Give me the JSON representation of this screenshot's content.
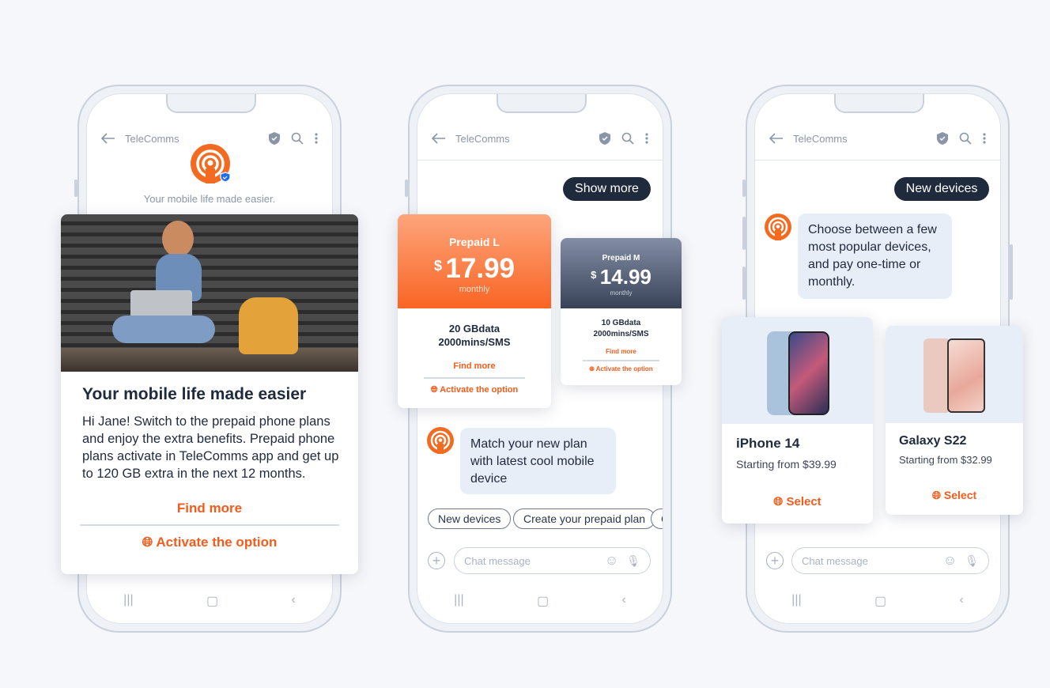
{
  "app_title": "TeleComms",
  "colors": {
    "accent": "#f35c1c",
    "dark": "#1f2a3d",
    "bubble": "#e8eef8"
  },
  "phone1": {
    "tagline": "Your mobile life made easier.",
    "card": {
      "title": "Your mobile life made easier",
      "body": "Hi Jane! Switch to the prepaid phone plans and enjoy the extra benefits. Prepaid phone plans activate in TeleComms app and get up to 120 GB extra in the next 12 months.",
      "find_more": "Find more",
      "activate": "Activate the option"
    }
  },
  "phone2": {
    "user_message": "Show more",
    "plans": [
      {
        "name": "Prepaid L",
        "currency": "$",
        "price": "17.99",
        "period": "monthly",
        "data": "20 GBdata",
        "mins": "2000mins/SMS",
        "find_more": "Find more",
        "activate": "Activate the option"
      },
      {
        "name": "Prepaid M",
        "currency": "$",
        "price": "14.99",
        "period": "monthly",
        "data": "10 GBdata",
        "mins": "2000mins/SMS",
        "find_more": "Find more",
        "activate": "Activate the option"
      }
    ],
    "bot_message": "Match your new plan with latest cool mobile device",
    "chips": [
      "New devices",
      "Create your prepaid plan",
      "C"
    ],
    "input_placeholder": "Chat message"
  },
  "phone3": {
    "user_message": "New devices",
    "bot_message": "Choose between a few most popular devices, and pay one-time or monthly.",
    "devices": [
      {
        "name": "iPhone 14",
        "price": "Starting from $39.99",
        "select": "Select"
      },
      {
        "name": "Galaxy S22",
        "price": "Starting from $32.99",
        "select": "Select"
      }
    ],
    "input_placeholder": "Chat message"
  },
  "icons": [
    "back-arrow-icon",
    "shield-check-icon",
    "search-icon",
    "more-vertical-icon",
    "globe-icon",
    "plus-icon",
    "emoji-icon",
    "microphone-icon",
    "recents-icon",
    "home-icon",
    "back-icon"
  ]
}
